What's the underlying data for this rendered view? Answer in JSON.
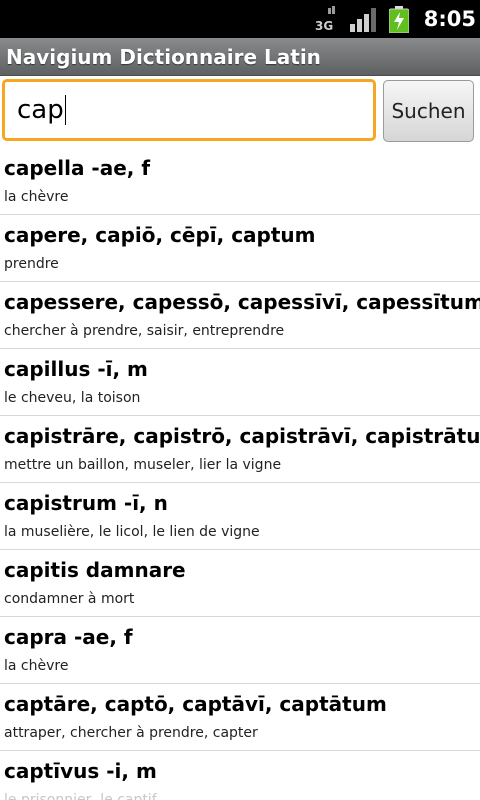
{
  "status_bar": {
    "network_label": "3G",
    "time": "8:05",
    "icons": [
      "3g-icon",
      "signal-icon",
      "battery-charging-icon"
    ]
  },
  "app": {
    "title": "Navigium Dictionnaire Latin"
  },
  "search": {
    "value": "cap",
    "button_label": "Suchen"
  },
  "results": [
    {
      "term": "capella -ae, f",
      "definition": "la chèvre"
    },
    {
      "term": "capere, capiō, cēpī, captum",
      "definition": "prendre"
    },
    {
      "term": "capessere, capessō, capessīvī, capessītum",
      "definition": "chercher à prendre, saisir, entreprendre"
    },
    {
      "term": "capillus -ī, m",
      "definition": "le cheveu, la toison"
    },
    {
      "term": "capistrāre, capistrō, capistrāvī, capistrātum",
      "definition": "mettre un baillon, museler, lier la vigne"
    },
    {
      "term": "capistrum -ī, n",
      "definition": "la muselière, le licol, le lien de vigne"
    },
    {
      "term": "capitis damnare",
      "definition": "condamner à mort"
    },
    {
      "term": "capra -ae, f",
      "definition": "la chèvre"
    },
    {
      "term": "captāre, captō, captāvī, captātum",
      "definition": "attraper, chercher à prendre, capter"
    },
    {
      "term": "captīvus -i, m",
      "definition": "le prisonnier, le captif"
    }
  ]
}
